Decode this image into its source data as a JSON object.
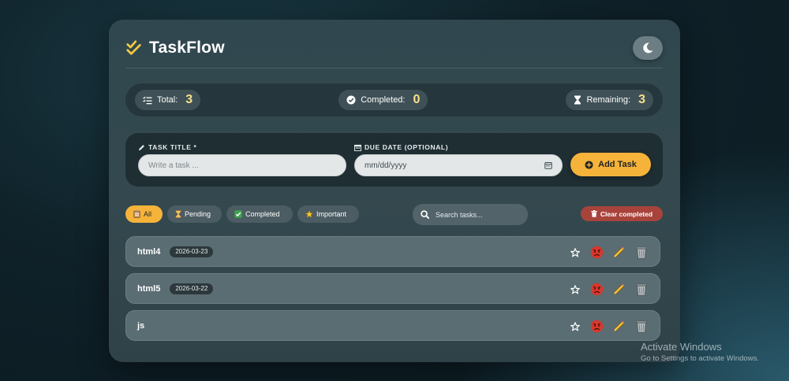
{
  "app": {
    "title": "TaskFlow"
  },
  "stats": {
    "total_label": "Total:",
    "total_value": "3",
    "completed_label": "Completed:",
    "completed_value": "0",
    "remaining_label": "Remaining:",
    "remaining_value": "3"
  },
  "form": {
    "title_label": "TASK TITLE *",
    "title_placeholder": "Write a task ...",
    "date_label": "DUE DATE (OPTIONAL)",
    "date_placeholder": "mm/dd/yyyy",
    "add_label": "Add Task"
  },
  "filters": {
    "all": "All",
    "pending": "Pending",
    "completed": "Completed",
    "important": "Important",
    "active": "All",
    "search_placeholder": "Search tasks...",
    "clear_label": "Clear completed"
  },
  "tasks": [
    {
      "title": "html4",
      "due": "2026-03-23"
    },
    {
      "title": "html5",
      "due": "2026-03-22"
    },
    {
      "title": "js",
      "due": ""
    }
  ],
  "watermark": {
    "line1": "Activate Windows",
    "line2": "Go to Settings to activate Windows."
  },
  "colors": {
    "accent": "#f5b33a",
    "danger": "#a8433c",
    "stat_value": "#f7e08b"
  }
}
